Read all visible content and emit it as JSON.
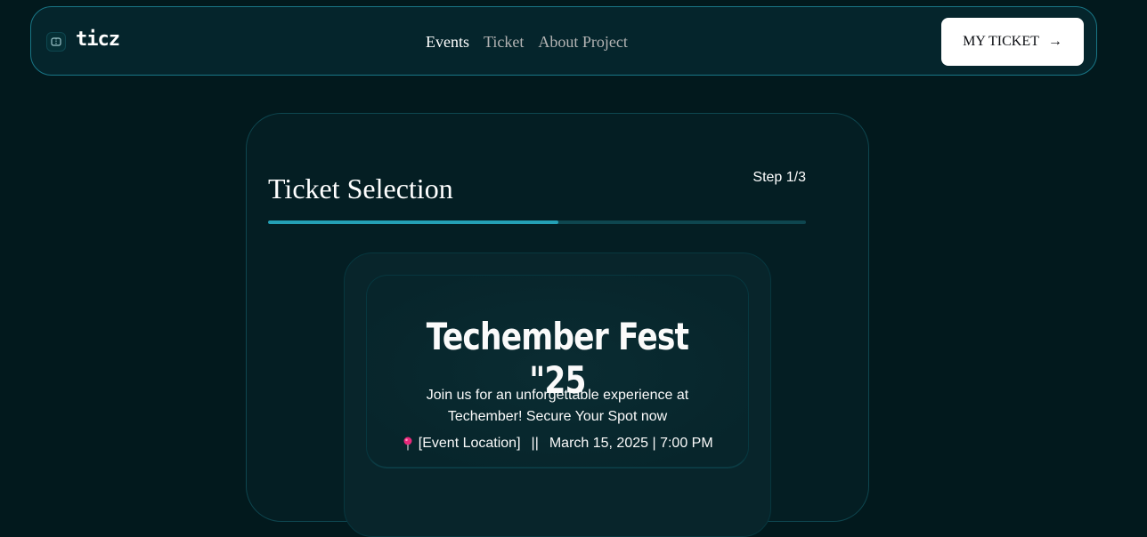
{
  "nav": {
    "logo_text": "ticz",
    "links": [
      {
        "label": "Events"
      },
      {
        "label": "Ticket"
      },
      {
        "label": "About Project"
      }
    ],
    "cta_label": "MY TICKET",
    "cta_arrow": "→"
  },
  "panel": {
    "title": "Ticket Selection",
    "step": "Step 1/3",
    "progress": 0.54
  },
  "event": {
    "title": "Techember Fest \"25",
    "description": "Join us for an unforgettable experience at Techember! Secure Your Spot now",
    "location": "[Event Location]",
    "separator": "||",
    "datetime": "March 15, 2025 | 7:00 PM"
  },
  "colors": {
    "background": "#02191d",
    "accent": "#24a0b5",
    "border": "#0e464f"
  }
}
